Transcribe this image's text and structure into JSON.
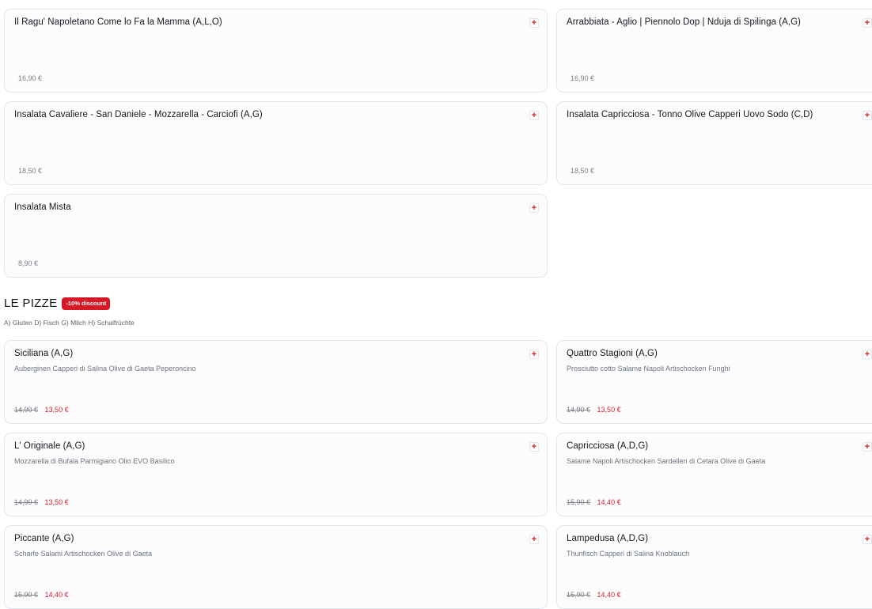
{
  "top_items": [
    {
      "name": "Il Ragu' Napoletano Come lo Fa la Mamma (A,L,O)",
      "price": "16,90 €"
    },
    {
      "name": "Arrabbiata - Aglio | Piennolo Dop | Nduja di Spilinga (A,G)",
      "price": "16,90 €"
    },
    {
      "name": "Insalata Cavaliere - San Daniele - Mozzarella - Carciofi (A,G)",
      "price": "18,50 €"
    },
    {
      "name": "Insalata Capricciosa - Tonno Olive Capperi Uovo Sodo (C,D)",
      "price": "18,50 €"
    },
    {
      "name": "Insalata Mista",
      "price": "8,90 €"
    }
  ],
  "add_label": "+",
  "pizze_section": {
    "title": "LE PIZZE",
    "discount": "-10% discount",
    "allergens": "A) Gluten D) Fisch G) Milch H) Schalfrüchte"
  },
  "pizze": [
    {
      "name": "Siciliana (A,G)",
      "description": "Auberginen Capperi di Salina Olive di Gaeta Peperoncino",
      "old_price": "14,90 €",
      "new_price": "13,50 €"
    },
    {
      "name": "Quattro Stagioni (A,G)",
      "description": "Prosciutto cotto Salame Napoli Artischocken Funghi",
      "old_price": "14,90 €",
      "new_price": "13,50 €"
    },
    {
      "name": "L' Originale (A,G)",
      "description": "Mozzarella di Bufala Parmigiano Olio EVO Basilico",
      "old_price": "14,90 €",
      "new_price": "13,50 €"
    },
    {
      "name": "Capricciosa (A,D,G)",
      "description": "Salame Napoli Artischocken Sardellen di Cetara Olive di Gaeta",
      "old_price": "15,90 €",
      "new_price": "14,40 €"
    },
    {
      "name": "Piccante (A,G)",
      "description": "Scharfe Salami Artischocken Olive di Gaeta",
      "old_price": "15,90 €",
      "new_price": "14,40 €"
    },
    {
      "name": "Lampedusa (A,D,G)",
      "description": "Thunfisch Capperi di Salina Knoblauch",
      "old_price": "15,90 €",
      "new_price": "14,40 €"
    }
  ],
  "colors": {
    "accent": "#d21f2b",
    "card_border": "#dfe6f0",
    "badge_bg": "#d61926"
  }
}
